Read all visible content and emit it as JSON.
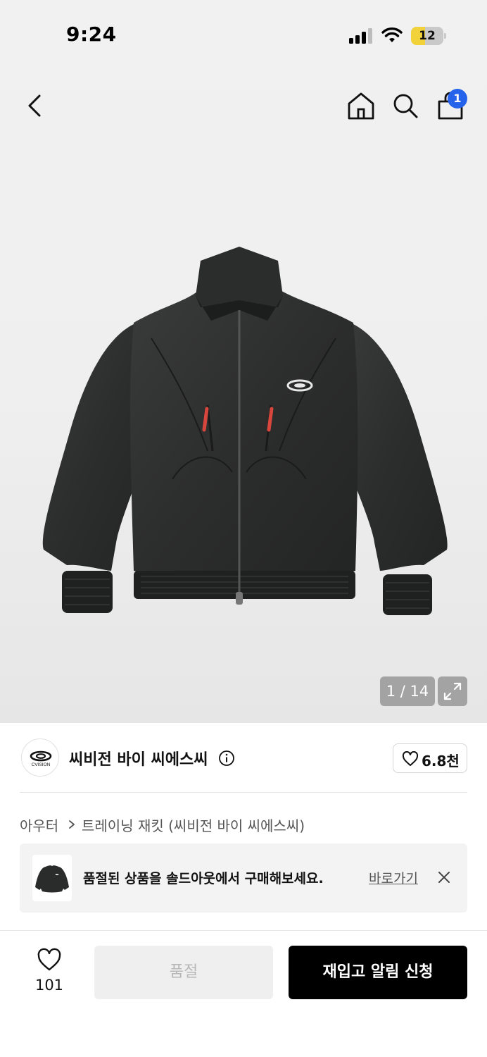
{
  "status_bar": {
    "time": "9:24",
    "battery_level": "12",
    "battery_color": "#f2d23a"
  },
  "header": {
    "back_icon": "chevron-left-icon",
    "home_icon": "home-icon",
    "search_icon": "search-icon",
    "bag_icon": "shopping-bag-icon",
    "cart_count": "1",
    "badge_color": "#2563eb"
  },
  "gallery": {
    "counter": "1 / 14",
    "expand_icon": "expand-icon"
  },
  "brand": {
    "name": "씨비전 바이 씨에스씨",
    "logo_text": "CVISION",
    "likes": "6.8천"
  },
  "breadcrumb": {
    "category": "아우터",
    "product": "트레이닝 재킷 (씨비전 바이 씨에스씨)"
  },
  "soldout_banner": {
    "message": "품절된 상품을 솔드아웃에서 구매해보세요.",
    "link_label": "바로가기"
  },
  "bottom_bar": {
    "like_count": "101",
    "soldout_label": "품절",
    "restock_label": "재입고 알림 신청"
  }
}
